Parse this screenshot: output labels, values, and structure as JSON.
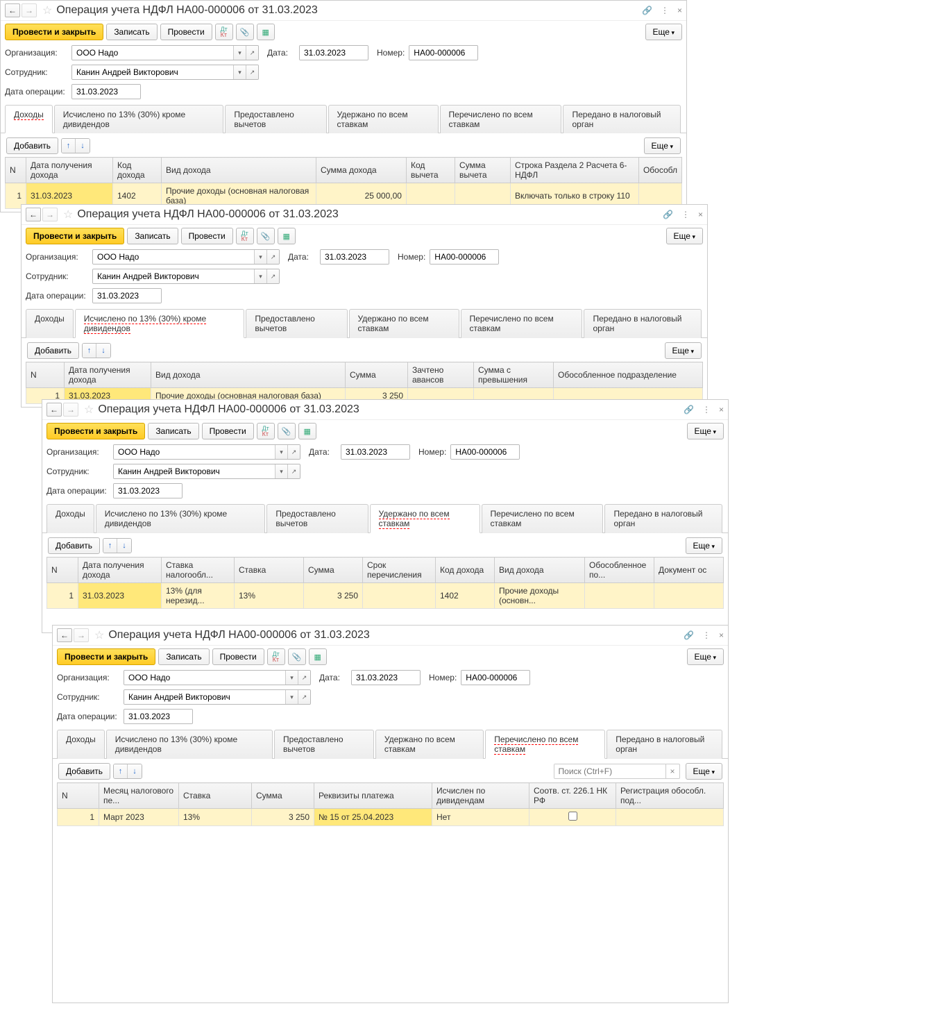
{
  "common": {
    "title": "Операция учета НДФЛ НА00-000006 от 31.03.2023",
    "btn_primary": "Провести и закрыть",
    "btn_write": "Записать",
    "btn_post": "Провести",
    "btn_more": "Еще",
    "lbl_org": "Организация:",
    "org": "ООО Надо",
    "lbl_date": "Дата:",
    "date": "31.03.2023",
    "lbl_num": "Номер:",
    "num": "НА00-000006",
    "lbl_emp": "Сотрудник:",
    "emp": "Канин Андрей Викторович",
    "lbl_opdate": "Дата операции:",
    "opdate": "31.03.2023",
    "tabs": [
      "Доходы",
      "Исчислено по 13% (30%) кроме дивидендов",
      "Предоставлено вычетов",
      "Удержано по всем ставкам",
      "Перечислено по всем ставкам",
      "Передано в налоговый орган"
    ],
    "btn_add": "Добавить",
    "search_ph": "Поиск (Ctrl+F)"
  },
  "win1": {
    "active_tab": 0,
    "headers": [
      "N",
      "Дата получения дохода",
      "Код дохода",
      "Вид дохода",
      "Сумма дохода",
      "Код вычета",
      "Сумма вычета",
      "Строка Раздела 2 Расчета 6-НДФЛ",
      "Обособл"
    ],
    "row": [
      "1",
      "31.03.2023",
      "1402",
      "Прочие доходы (основная налоговая база)",
      "25 000,00",
      "",
      "",
      "Включать только в строку 110",
      ""
    ]
  },
  "win2": {
    "active_tab": 1,
    "headers": [
      "N",
      "Дата получения дохода",
      "Вид дохода",
      "Сумма",
      "Зачтено авансов",
      "Сумма с превышения",
      "Обособленное подразделение"
    ],
    "row": [
      "1",
      "31.03.2023",
      "Прочие доходы (основная налоговая база)",
      "3 250",
      "",
      "",
      ""
    ]
  },
  "win3": {
    "active_tab": 3,
    "headers": [
      "N",
      "Дата получения дохода",
      "Ставка налогообл...",
      "Ставка",
      "Сумма",
      "Срок перечисления",
      "Код дохода",
      "Вид дохода",
      "Обособленное по...",
      "Документ ос"
    ],
    "row": [
      "1",
      "31.03.2023",
      "13% (для нерезид...",
      "13%",
      "3 250",
      "",
      "1402",
      "Прочие доходы (основн...",
      "",
      ""
    ]
  },
  "win4": {
    "active_tab": 4,
    "headers": [
      "N",
      "Месяц налогового пе...",
      "Ставка",
      "Сумма",
      "Реквизиты платежа",
      "Исчислен по дивидендам",
      "Соотв. ст. 226.1 НК РФ",
      "Регистрация обособл. под..."
    ],
    "row": [
      "1",
      "Март 2023",
      "13%",
      "3 250",
      "№ 15 от 25.04.2023",
      "Нет",
      "",
      ""
    ]
  }
}
